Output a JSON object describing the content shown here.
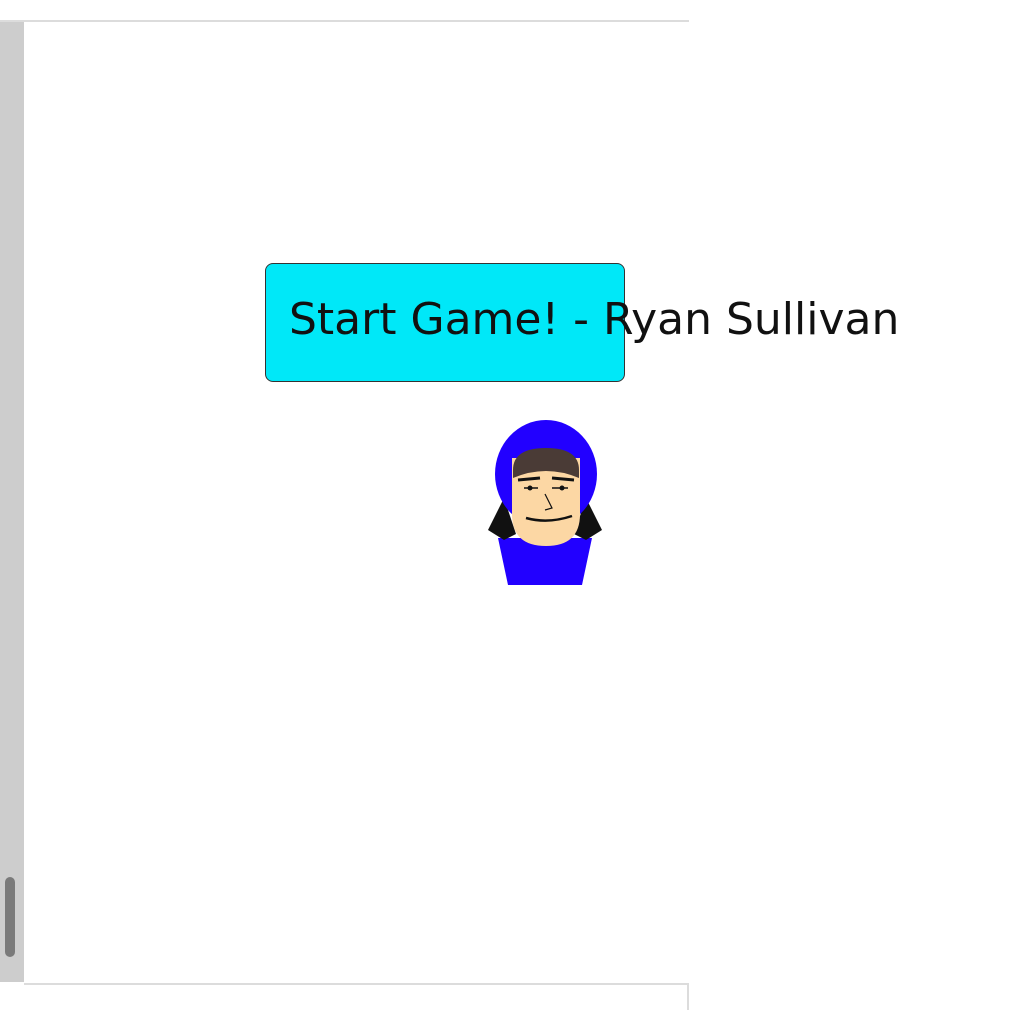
{
  "game": {
    "start_button_label": "Start Game! - Ryan Sullivan",
    "character_name": "character-sprite"
  },
  "colors": {
    "button_fill": "#00e8f8",
    "hood_blue": "#2200ff",
    "skin": "#fcd7a4",
    "hair_brown": "#4a3b36",
    "scrollbar_track": "#cdcdcd",
    "scrollbar_thumb": "#7a7a7a"
  }
}
